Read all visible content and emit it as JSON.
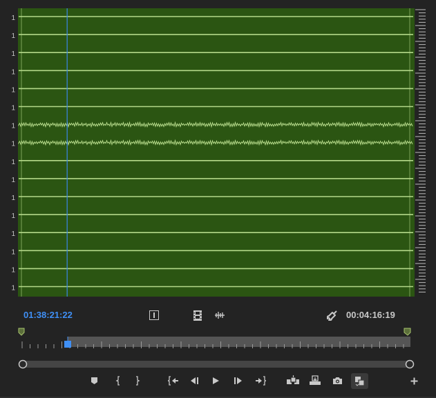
{
  "monitor": {
    "channel_labels": [
      "1",
      "1",
      "1",
      "1",
      "1",
      "1",
      "1",
      "1",
      "1",
      "1",
      "1",
      "1",
      "1",
      "1",
      "1",
      "1"
    ],
    "active_channels": [
      7,
      8
    ],
    "waveform_bg": "#2b5512",
    "channel_line_color": "#b5d98a",
    "playhead_color": "#3a86e8",
    "playhead_position": 0.124
  },
  "timecode": {
    "current": "01:38:21:22",
    "duration": "00:04:16:19"
  },
  "controls": {
    "accent": "#3f8ff5",
    "toolbar_icons": [
      "safe-margins-icon",
      "dropped-frame-indicator-icon",
      "audio-waveform-toggle-icon",
      "wrench-icon"
    ],
    "transport_buttons": [
      "add-marker",
      "mark-in",
      "mark-out",
      "go-to-in",
      "step-back",
      "play",
      "step-forward",
      "go-to-out",
      "insert",
      "overwrite",
      "export-frame",
      "compare-view"
    ]
  }
}
